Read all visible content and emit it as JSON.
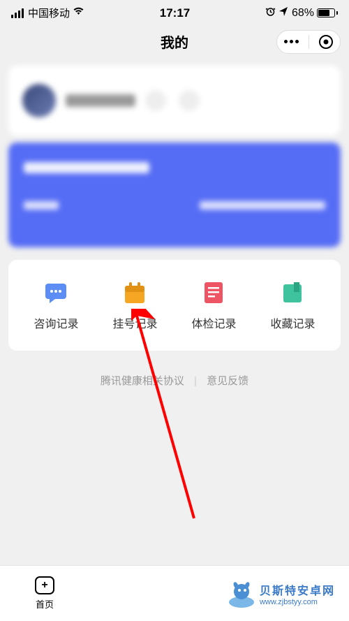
{
  "status": {
    "carrier": "中国移动",
    "time": "17:17",
    "battery_percent": "68%"
  },
  "header": {
    "title": "我的"
  },
  "menu": {
    "items": [
      {
        "label": "咨询记录",
        "icon": "chat"
      },
      {
        "label": "挂号记录",
        "icon": "calendar"
      },
      {
        "label": "体检记录",
        "icon": "document"
      },
      {
        "label": "收藏记录",
        "icon": "bookmark"
      }
    ]
  },
  "footer": {
    "link1": "腾讯健康相关协议",
    "link2": "意见反馈"
  },
  "bottom": {
    "home_label": "首页"
  },
  "watermark": {
    "name": "贝斯特安卓网",
    "url": "www.zjbstyy.com"
  }
}
